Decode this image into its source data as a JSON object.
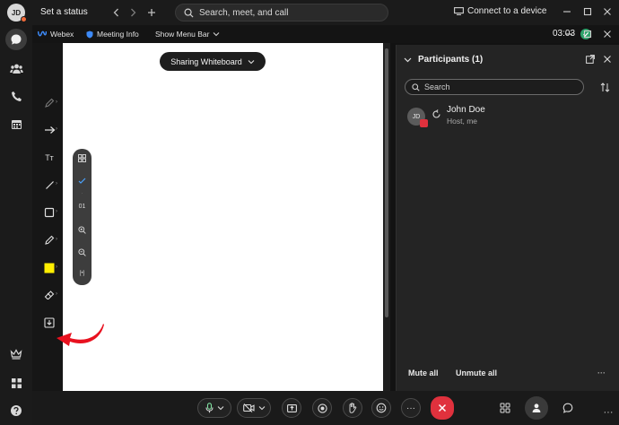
{
  "topbar": {
    "avatar_initials": "JD",
    "set_status": "Set a status",
    "search_placeholder": "Search, meet, and call",
    "connect_label": "Connect to a device"
  },
  "meeting_bar": {
    "app_name": "Webex",
    "meeting_info": "Meeting Info",
    "show_menu_bar": "Show Menu Bar",
    "timer": "03:03"
  },
  "whiteboard": {
    "sharing_label": "Sharing Whiteboard",
    "text_tool": "Tт",
    "floating_page": "01",
    "floating_fit": "[•]"
  },
  "participants": {
    "title": "Participants (1)",
    "search_placeholder": "Search",
    "list": [
      {
        "initials": "JD",
        "name": "John Doe",
        "role": "Host, me"
      }
    ],
    "mute_all": "Mute all",
    "unmute_all": "Unmute all",
    "more": "···"
  },
  "controls": {
    "more": "···"
  },
  "colors": {
    "accent_yellow": "#ffee00",
    "end_red": "#e0313d",
    "arrow_red": "#e8111f",
    "status_green": "#2ea36b"
  }
}
